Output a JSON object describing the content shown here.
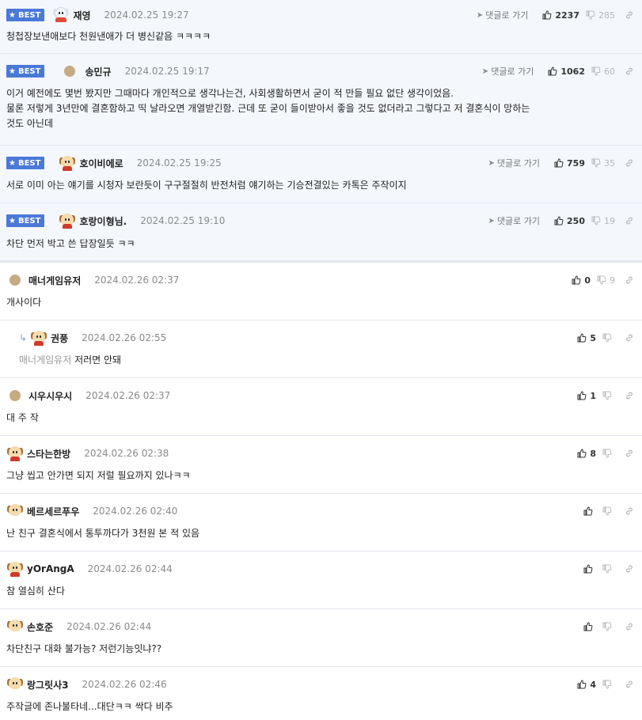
{
  "labels": {
    "best_badge": "BEST",
    "reply_link": "댓글로 가기"
  },
  "best_comments": [
    {
      "author": "재영",
      "date": "2024.02.25 19:27",
      "up": "2237",
      "down": "285",
      "lines": [
        "청첩장보낸애보다 천원낸애가 더 병신같음 ㅋㅋㅋㅋ"
      ]
    },
    {
      "author": "송민규",
      "date": "2024.02.25 19:17",
      "up": "1062",
      "down": "60",
      "lines": [
        "이거 예전에도 몇번 봤지만 그때마다 개인적으로 생각나는건, 사회생활하면서 굳이 적 만들 필요 없단 생각이었음.",
        "물론 저렇게 3년만에 결혼함하고 띡 날라오면 개열받긴함. 근데 또 굳이 들이받아서 좋을 것도 없더라고 그렇다고 저 결혼식이 망하는",
        "것도 아닌데"
      ]
    },
    {
      "author": "호이비에로",
      "date": "2024.02.25 19:25",
      "up": "759",
      "down": "35",
      "lines": [
        "서로 이미 아는 얘기를 시청자 보란듯이 구구절절히 반전처럼 얘기하는 기승전결있는 카톡은 주작이지"
      ]
    },
    {
      "author": "호랑이형님.",
      "date": "2024.02.25 19:10",
      "up": "250",
      "down": "19",
      "lines": [
        "차단 먼저 박고 쓴 답장일듯 ㅋㅋ"
      ]
    }
  ],
  "comments": [
    {
      "author": "매너게임유저",
      "date": "2024.02.26 02:37",
      "up": "0",
      "down": "9",
      "text": "개사이다"
    },
    {
      "author": "권풍",
      "date": "2024.02.26 02:55",
      "up": "5",
      "down": "",
      "mention": "매너게임유저",
      "text": "저러면 안돼"
    },
    {
      "author": "시우시우시",
      "date": "2024.02.26 02:37",
      "up": "1",
      "down": "",
      "text": "대 주 작"
    },
    {
      "author": "스타는한방",
      "date": "2024.02.26 02:38",
      "up": "8",
      "down": "",
      "text": "그냥 씹고 안가면 되지 저럴 필요까지 있나ㅋㅋ"
    },
    {
      "author": "베르세르푸우",
      "date": "2024.02.26 02:40",
      "up": "",
      "down": "",
      "text": "난 친구 결혼식에서 통투까다가 3천원 본 적 있음"
    },
    {
      "author": "yOrAngA",
      "date": "2024.02.26 02:44",
      "up": "",
      "down": "",
      "text": "참 열심히 산다"
    },
    {
      "author": "손호준",
      "date": "2024.02.26 02:44",
      "up": "",
      "down": "",
      "text": "차단친구 대화 불가능? 저런기능잇냐??"
    },
    {
      "author": "랑그릿사3",
      "date": "2024.02.26 02:46",
      "up": "4",
      "down": "",
      "text": "주작글에 존나불타네...대단ㅋㅋ 싹다 비추"
    }
  ]
}
